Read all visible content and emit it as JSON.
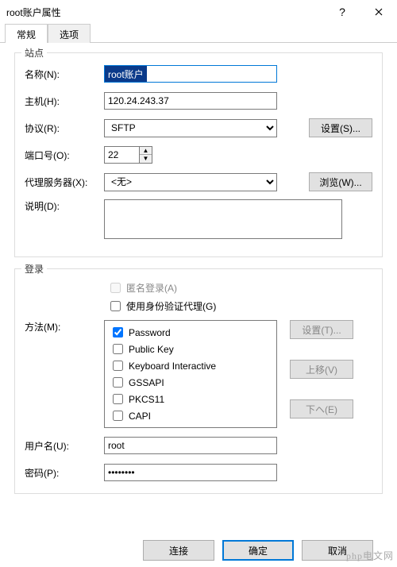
{
  "title": "root账户属性",
  "tabs": {
    "general": "常规",
    "options": "选项",
    "active": 0
  },
  "site": {
    "legend": "站点",
    "name_label": "名称(N):",
    "name_value": "root账户",
    "host_label": "主机(H):",
    "host_value": "120.24.243.37",
    "protocol_label": "协议(R):",
    "protocol_value": "SFTP",
    "protocol_set_btn": "设置(S)...",
    "port_label": "端口号(O):",
    "port_value": "22",
    "proxy_label": "代理服务器(X):",
    "proxy_value": "<无>",
    "proxy_browse_btn": "浏览(W)...",
    "desc_label": "说明(D):",
    "desc_value": ""
  },
  "login": {
    "legend": "登录",
    "anon_label": "匿名登录(A)",
    "auth_agent_label": "使用身份验证代理(G)",
    "method_label": "方法(M):",
    "methods": [
      {
        "label": "Password",
        "checked": true
      },
      {
        "label": "Public Key",
        "checked": false
      },
      {
        "label": "Keyboard Interactive",
        "checked": false
      },
      {
        "label": "GSSAPI",
        "checked": false
      },
      {
        "label": "PKCS11",
        "checked": false
      },
      {
        "label": "CAPI",
        "checked": false
      }
    ],
    "set_btn": "设置(T)...",
    "up_btn": "上移(V)",
    "down_btn": "下ヘ(E)",
    "user_label": "用户名(U):",
    "user_value": "root",
    "pass_label": "密码(P):",
    "pass_value": "••••••••"
  },
  "buttons": {
    "connect": "连接",
    "ok": "确定",
    "cancel": "取消"
  },
  "watermark": "php电文网"
}
